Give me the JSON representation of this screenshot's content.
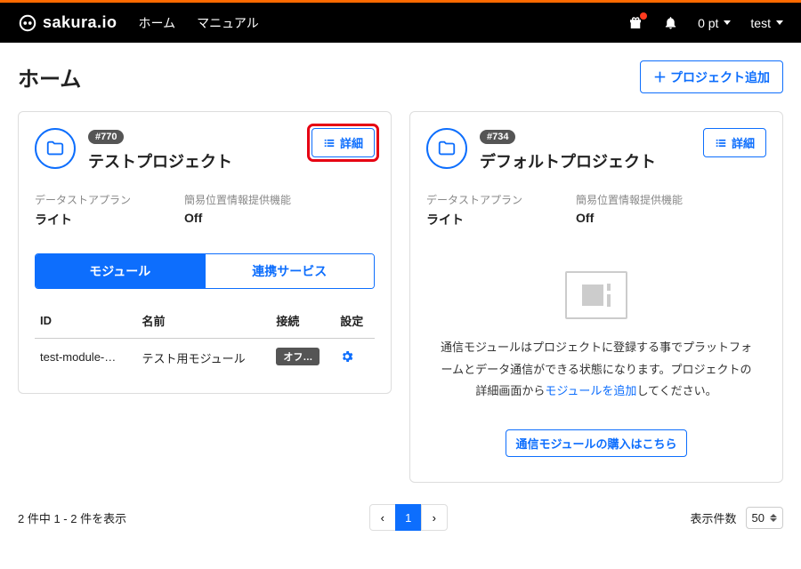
{
  "header": {
    "brand": "sakura.io",
    "nav": {
      "home": "ホーム",
      "manual": "マニュアル"
    },
    "points": "0 pt",
    "user": "test"
  },
  "page": {
    "title": "ホーム",
    "add_project_label": "プロジェクト追加"
  },
  "projects": [
    {
      "id_badge": "#770",
      "name": "テストプロジェクト",
      "detail_label": "詳細",
      "meta": {
        "plan_label": "データストアプラン",
        "plan_value": "ライト",
        "location_label": "簡易位置情報提供機能",
        "location_value": "Off"
      },
      "tabs": {
        "modules": "モジュール",
        "services": "連携サービス"
      },
      "table": {
        "headers": {
          "id": "ID",
          "name": "名前",
          "conn": "接続",
          "settings": "設定"
        },
        "rows": [
          {
            "id": "test-module-…",
            "name": "テスト用モジュール",
            "conn": "オフ…"
          }
        ]
      }
    },
    {
      "id_badge": "#734",
      "name": "デフォルトプロジェクト",
      "detail_label": "詳細",
      "meta": {
        "plan_label": "データストアプラン",
        "plan_value": "ライト",
        "location_label": "簡易位置情報提供機能",
        "location_value": "Off"
      },
      "empty": {
        "text_before": "通信モジュールはプロジェクトに登録する事でプラットフォームとデータ通信ができる状態になります。プロジェクトの詳細画面から",
        "link": "モジュールを追加",
        "text_after": "してください。",
        "buy_label": "通信モジュールの購入はこちら"
      }
    }
  ],
  "footer": {
    "range_text": "2 件中 1 - 2 件を表示",
    "page_current": "1",
    "per_page_label": "表示件数",
    "per_page_value": "50"
  }
}
